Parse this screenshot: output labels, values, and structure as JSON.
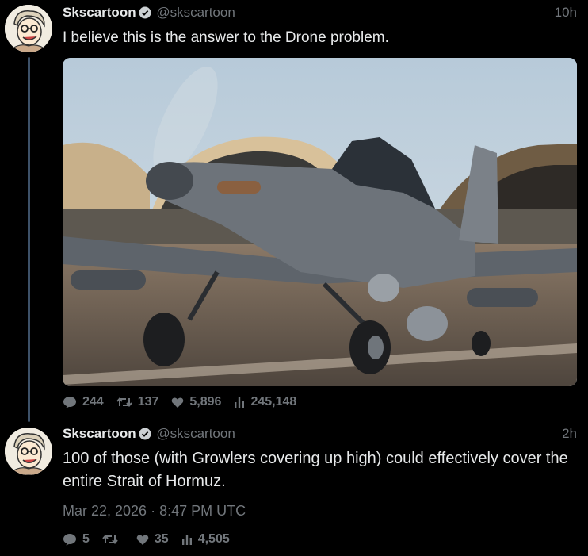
{
  "tweets": [
    {
      "author_name": "Skscartoon",
      "handle": "@skscartoon",
      "time": "10h",
      "text": "I believe this is the answer to the Drone problem.",
      "stats": {
        "replies": "244",
        "retweets": "137",
        "likes": "5,896",
        "views": "245,148"
      }
    },
    {
      "author_name": "Skscartoon",
      "handle": "@skscartoon",
      "time": "2h",
      "text": "100 of those  (with Growlers covering up high) could effectively cover the entire Strait of Hormuz.",
      "date": "Mar 22, 2026 · 8:47 PM UTC",
      "stats": {
        "replies": "5",
        "retweets": "",
        "likes": "35",
        "views": "4,505"
      }
    }
  ],
  "colors": {
    "verified": "#1d9bf0",
    "muted": "#71767b",
    "thread_line": "#3d5168"
  },
  "icons": [
    "reply-icon",
    "retweet-icon",
    "like-icon",
    "views-icon",
    "verified-icon"
  ]
}
